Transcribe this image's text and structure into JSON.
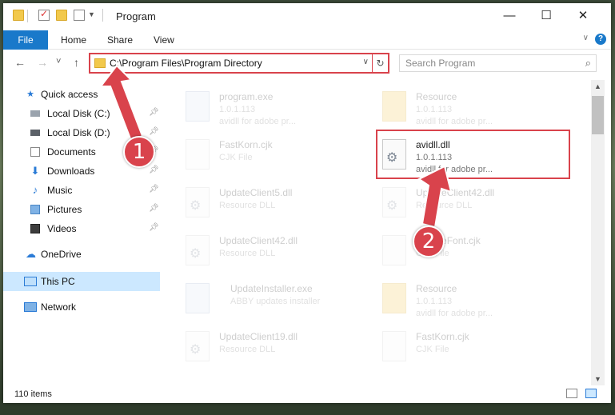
{
  "window": {
    "title": "Program",
    "minimize": "—",
    "maximize": "☐",
    "close": "✕"
  },
  "ribbon": {
    "tabs": [
      "File",
      "Home",
      "Share",
      "View"
    ],
    "help": "?"
  },
  "nav": {
    "back": "←",
    "forward": "→",
    "recent": "˅",
    "up": "↑",
    "address": "C:\\Program Files\\Program Directory",
    "search_placeholder": "Search Program"
  },
  "sidebar": {
    "items": [
      {
        "label": "Quick access",
        "icon": "star-icon",
        "pinned": false
      },
      {
        "label": "Local Disk (C:)",
        "icon": "drive-icon",
        "pinned": true
      },
      {
        "label": "Local Disk (D:)",
        "icon": "drive-icon",
        "pinned": true
      },
      {
        "label": "Documents",
        "icon": "documents-icon",
        "pinned": true
      },
      {
        "label": "Downloads",
        "icon": "download-icon",
        "pinned": true
      },
      {
        "label": "Music",
        "icon": "music-icon",
        "pinned": true
      },
      {
        "label": "Pictures",
        "icon": "pictures-icon",
        "pinned": true
      },
      {
        "label": "Videos",
        "icon": "videos-icon",
        "pinned": true
      },
      {
        "label": "OneDrive",
        "icon": "cloud-icon",
        "pinned": false
      },
      {
        "label": "This PC",
        "icon": "computer-icon",
        "pinned": false,
        "selected": true
      },
      {
        "label": "Network",
        "icon": "network-icon",
        "pinned": false
      }
    ]
  },
  "files": [
    {
      "name": "program.exe",
      "line1": "1.0.1.113",
      "line2": "avidll for adobe pr...",
      "type": "app"
    },
    {
      "name": "Resource",
      "line1": "1.0.1.113",
      "line2": "avidll for adobe pr...",
      "type": "folder"
    },
    {
      "name": "FastKorn.cjk",
      "line1": "CJK File",
      "line2": "",
      "type": "doc"
    },
    {
      "name": "avidll.dll",
      "line1": "1.0.1.113",
      "line2": "avidll for adobe pr...",
      "type": "dll",
      "highlighted": true
    },
    {
      "name": "UpdateClient5.dll",
      "line1": "Resource DLL",
      "line2": "",
      "type": "dll"
    },
    {
      "name": "UpdateClient42.dll",
      "line1": "Resource DLL",
      "line2": "",
      "type": "dll"
    },
    {
      "name": "UpdateClient42.dll",
      "line1": "Resource DLL",
      "line2": "",
      "type": "dll"
    },
    {
      "name": "UpdateFont.cjk",
      "line1": "CJK File",
      "line2": "",
      "type": "doc"
    },
    {
      "name": "UpdateInstaller.exe",
      "line1": "ABBY updates installer",
      "line2": "",
      "type": "app"
    },
    {
      "name": "Resource",
      "line1": "1.0.1.113",
      "line2": "avidll for adobe pr...",
      "type": "folder"
    },
    {
      "name": "UpdateClient19.dll",
      "line1": "Resource DLL",
      "line2": "",
      "type": "dll"
    },
    {
      "name": "FastKorn.cjk",
      "line1": "CJK File",
      "line2": "",
      "type": "doc"
    }
  ],
  "status": {
    "item_count": "110 items"
  },
  "annotations": {
    "step1": "1",
    "step2": "2",
    "color": "#d9434c"
  }
}
